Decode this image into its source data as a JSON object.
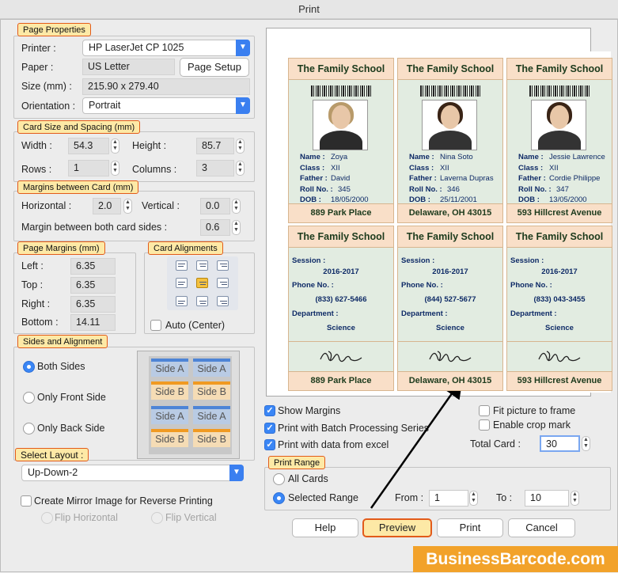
{
  "window": {
    "title": "Print"
  },
  "page_properties": {
    "title": "Page Properties",
    "printer_label": "Printer :",
    "printer_value": "HP LaserJet CP 1025",
    "paper_label": "Paper :",
    "paper_value": "US Letter",
    "page_setup_button": "Page Setup",
    "size_label": "Size (mm) :",
    "size_value": "215.90 x 279.40",
    "orientation_label": "Orientation :",
    "orientation_value": "Portrait"
  },
  "card_size": {
    "title": "Card Size and Spacing (mm)",
    "width_label": "Width :",
    "width_value": "54.3",
    "height_label": "Height :",
    "height_value": "85.7",
    "rows_label": "Rows :",
    "rows_value": "1",
    "columns_label": "Columns :",
    "columns_value": "3"
  },
  "margins_between": {
    "title": "Margins between Card (mm)",
    "horizontal_label": "Horizontal :",
    "horizontal_value": "2.0",
    "vertical_label": "Vertical :",
    "vertical_value": "0.0",
    "both_sides_label": "Margin between both card sides :",
    "both_sides_value": "0.6"
  },
  "page_margins": {
    "title": "Page Margins (mm)",
    "left_label": "Left :",
    "left_value": "6.35",
    "top_label": "Top :",
    "top_value": "6.35",
    "right_label": "Right :",
    "right_value": "6.35",
    "bottom_label": "Bottom :",
    "bottom_value": "14.11"
  },
  "card_alignments": {
    "title": "Card Alignments",
    "auto_center_label": "Auto (Center)"
  },
  "sides": {
    "title": "Sides and Alignment",
    "both": "Both Sides",
    "front": "Only Front Side",
    "back": "Only Back Side",
    "layout_boxes": [
      "Side A",
      "Side A",
      "Side B",
      "Side B",
      "Side A",
      "Side A",
      "Side B",
      "Side B"
    ]
  },
  "select_layout": {
    "title": "Select Layout :",
    "value": "Up-Down-2"
  },
  "mirror": {
    "label": "Create Mirror Image for Reverse Printing",
    "flip_h": "Flip Horizontal",
    "flip_v": "Flip Vertical"
  },
  "options": {
    "show_margins": "Show Margins",
    "batch": "Print with Batch Processing Series",
    "excel": "Print with data from excel",
    "fit_picture": "Fit picture to frame",
    "crop_mark": "Enable crop mark",
    "total_card_label": "Total Card :",
    "total_card_value": "30"
  },
  "print_range": {
    "title": "Print Range",
    "all_cards": "All Cards",
    "selected_range": "Selected Range",
    "from_label": "From :",
    "from_value": "1",
    "to_label": "To :",
    "to_value": "10"
  },
  "buttons": {
    "help": "Help",
    "preview": "Preview",
    "print": "Print",
    "cancel": "Cancel"
  },
  "cards_front": [
    {
      "school": "The Family School",
      "name": "Zoya",
      "class": "XII",
      "father": "David",
      "roll": "345",
      "dob": "18/05/2000",
      "address": "889 Park Place"
    },
    {
      "school": "The Family School",
      "name": "Nina Soto",
      "class": "XII",
      "father": "Laverna Dupras",
      "roll": "346",
      "dob": "25/11/2001",
      "address": "Delaware, OH 43015"
    },
    {
      "school": "The Family School",
      "name": "Jessie Lawrence",
      "class": "XII",
      "father": "Cordie Philippe",
      "roll": "347",
      "dob": "13/05/2000",
      "address": "593 Hillcrest Avenue"
    }
  ],
  "cards_back": [
    {
      "school": "The Family School",
      "session": "2016-2017",
      "phone": "(833) 627-5466",
      "department": "Science",
      "address": "889 Park Place"
    },
    {
      "school": "The Family School",
      "session": "2016-2017",
      "phone": "(844) 527-5677",
      "department": "Science",
      "address": "Delaware, OH 43015"
    },
    {
      "school": "The Family School",
      "session": "2016-2017",
      "phone": "(833) 043-3455",
      "department": "Science",
      "address": "593 Hillcrest Avenue"
    }
  ],
  "field_labels": {
    "name": "Name :",
    "class": "Class :",
    "father": "Father :",
    "roll": "Roll No. :",
    "dob": "DOB :",
    "session": "Session :",
    "phone": "Phone No. :",
    "department": "Department :"
  },
  "brand": "BusinessBarcode.com"
}
